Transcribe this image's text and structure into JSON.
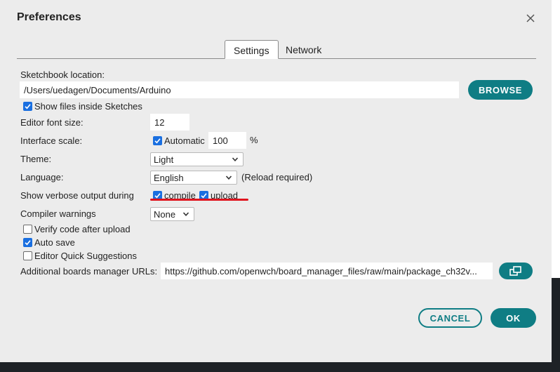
{
  "dialog": {
    "title": "Preferences",
    "tabs": [
      {
        "label": "Settings",
        "active": true
      },
      {
        "label": "Network",
        "active": false
      }
    ]
  },
  "settings": {
    "sketchbook_location_label": "Sketchbook location:",
    "sketchbook_location_value": "/Users/uedagen/Documents/Arduino",
    "browse_label": "BROWSE",
    "show_files_label": "Show files inside Sketches",
    "show_files_checked": true,
    "editor_font_size_label": "Editor font size:",
    "editor_font_size_value": "12",
    "interface_scale_label": "Interface scale:",
    "interface_scale_automatic_label": "Automatic",
    "interface_scale_automatic_checked": true,
    "interface_scale_value": "100",
    "interface_scale_unit": "%",
    "theme_label": "Theme:",
    "theme_value": "Light",
    "language_label": "Language:",
    "language_value": "English",
    "language_note": "(Reload required)",
    "verbose_label": "Show verbose output during",
    "verbose_compile_label": "compile",
    "verbose_compile_checked": true,
    "verbose_upload_label": "upload",
    "verbose_upload_checked": true,
    "compiler_warnings_label": "Compiler warnings",
    "compiler_warnings_value": "None",
    "verify_label": "Verify code after upload",
    "verify_checked": false,
    "autosave_label": "Auto save",
    "autosave_checked": true,
    "quick_suggestions_label": "Editor Quick Suggestions",
    "quick_suggestions_checked": false,
    "boards_urls_label": "Additional boards manager URLs:",
    "boards_urls_value": "https://github.com/openwch/board_manager_files/raw/main/package_ch32v..."
  },
  "footer": {
    "cancel_label": "CANCEL",
    "ok_label": "OK"
  },
  "colors": {
    "accent": "#0f7d84",
    "checkbox": "#1a6fe0",
    "annotation": "#e0141e"
  },
  "icons": {
    "close": "close-icon",
    "check": "checkmark-icon",
    "dropdown": "chevron-down-icon",
    "urls_editor": "open-window-icon"
  }
}
